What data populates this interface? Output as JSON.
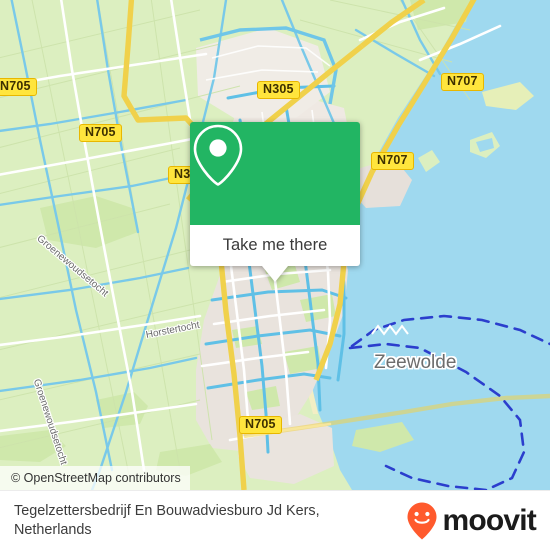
{
  "map": {
    "provider_attribution": "© OpenStreetMap contributors",
    "city_label": "Zeewolde",
    "road_shields": [
      {
        "label": "N705"
      },
      {
        "label": "N705"
      },
      {
        "label": "N305"
      },
      {
        "label": "N707"
      },
      {
        "label": "N3"
      },
      {
        "label": "N707"
      },
      {
        "label": "N705"
      }
    ],
    "street_labels": [
      {
        "text": "Groenewoudsetocht"
      },
      {
        "text": "Groenewoudsetocht"
      },
      {
        "text": "Horstertocht"
      }
    ],
    "colors": {
      "water": "#9fd9ef",
      "farmland": "#dcefc0",
      "builtup": "#e9e3dd",
      "road_major": "#f5d23c",
      "canal": "#73c9e8",
      "boundary": "#2b3ecd"
    }
  },
  "popup": {
    "icon": "map-pin-icon",
    "cta_label": "Take me there",
    "green": "#22b563"
  },
  "footer": {
    "place_name": "Tegelzettersbedrijf En Bouwadviesburo Jd Kers, Netherlands",
    "brand_name": "moovit",
    "brand_color": "#ff5a2d"
  }
}
